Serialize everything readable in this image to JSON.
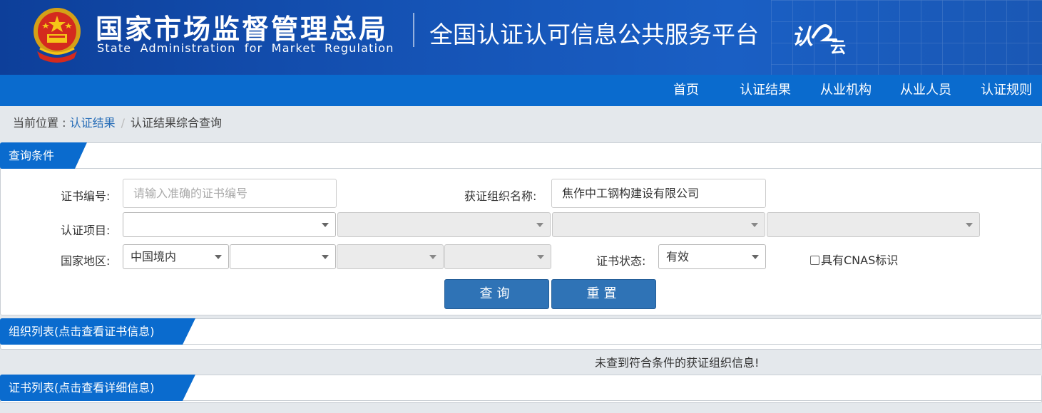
{
  "header": {
    "agency_cn": "国家市场监督管理总局",
    "agency_en": "State Administration  for  Market Regulation",
    "platform_title": "全国认证认可信息公共服务平台",
    "logo_text_1": "认",
    "logo_text_2": "云"
  },
  "nav": {
    "items": [
      {
        "label": "首页"
      },
      {
        "label": "认证结果"
      },
      {
        "label": "从业机构"
      },
      {
        "label": "从业人员"
      },
      {
        "label": "认证规则"
      }
    ]
  },
  "breadcrumb": {
    "prefix": "当前位置 : ",
    "link": "认证结果",
    "separator": "/",
    "current": "认证结果综合查询"
  },
  "query": {
    "tab_title": "查询条件",
    "cert_no_label": "证书编号:",
    "cert_no_placeholder": "请输入准确的证书编号",
    "org_name_label": "获证组织名称:",
    "org_name_value": "焦作中工钢构建设有限公司",
    "project_label": "认证项目:",
    "region_label": "国家地区:",
    "region_value": "中国境内",
    "status_label": "证书状态:",
    "status_value": "有效",
    "cnas_label": "具有CNAS标识",
    "search_button": "查询",
    "reset_button": "重置"
  },
  "org_list": {
    "tab_title": "组织列表(点击查看证书信息)",
    "empty_message": "未查到符合条件的获证组织信息!"
  },
  "cert_list": {
    "tab_title": "证书列表(点击查看详细信息)"
  },
  "colors": {
    "banner": "#1553b5",
    "nav": "#0a6bce",
    "tab": "#0a6bce",
    "button": "#2f73b6"
  }
}
